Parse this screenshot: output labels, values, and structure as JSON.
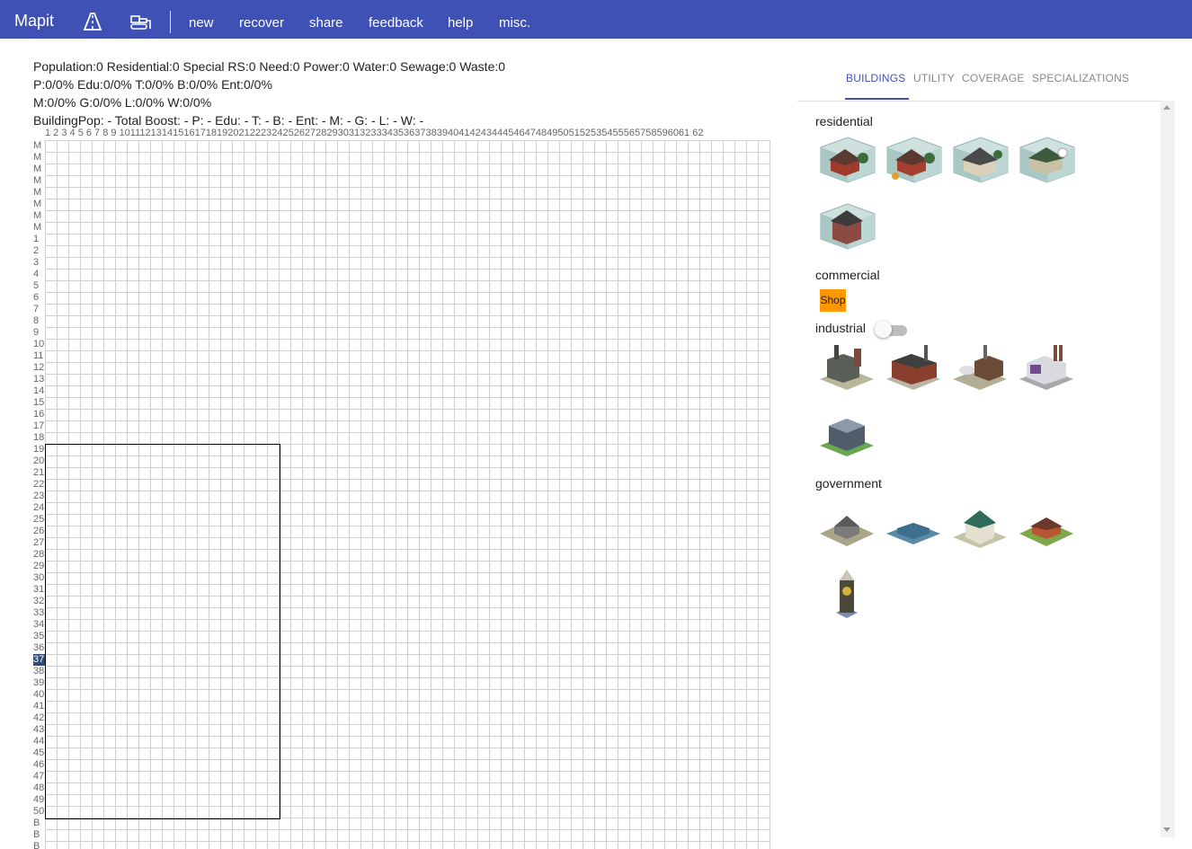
{
  "app": {
    "title": "Mapit"
  },
  "toolbar": {
    "icons": [
      "road-icon",
      "bulldozer-icon"
    ],
    "nav": [
      "new",
      "recover",
      "share",
      "feedback",
      "help",
      "misc."
    ]
  },
  "stats": {
    "line1": "Population:0  Residential:0  Special RS:0  Need:0  Power:0  Water:0  Sewage:0  Waste:0",
    "line2": "P:0/0%  Edu:0/0%  T:0/0%  B:0/0%  Ent:0/0%",
    "line3": "M:0/0%  G:0/0%  L:0/0%  W:0/0%",
    "line4": "BuildingPop: -  Total Boost: -  P: -  Edu: -  T: -  B: -  Ent: -  M: -  G: -  L: -  W: -"
  },
  "grid": {
    "column_numbers": "1 2 3 4 5 6 7 8 9 10111213141516171819202122232425262728293031323334353637383940414243444546474849505152535455565758596061 62",
    "row_labels": [
      "M",
      "M",
      "M",
      "M",
      "M",
      "M",
      "M",
      "M",
      "1",
      "2",
      "3",
      "4",
      "5",
      "6",
      "7",
      "8",
      "9",
      "10",
      "11",
      "12",
      "13",
      "14",
      "15",
      "16",
      "17",
      "18",
      "19",
      "20",
      "21",
      "22",
      "23",
      "24",
      "25",
      "26",
      "27",
      "28",
      "29",
      "30",
      "31",
      "32",
      "33",
      "34",
      "35",
      "36",
      "37",
      "38",
      "39",
      "40",
      "41",
      "42",
      "43",
      "44",
      "45",
      "46",
      "47",
      "48",
      "49",
      "50",
      "B",
      "B",
      "B"
    ],
    "highlighted_row": "37"
  },
  "tabs": [
    "BUILDINGS",
    "UTILITY",
    "COVERAGE",
    "SPECIALIZATIONS"
  ],
  "active_tab": "BUILDINGS",
  "panel": {
    "residential": {
      "label": "residential",
      "count": 5
    },
    "commercial": {
      "label": "commercial",
      "shop_label": "Shop"
    },
    "industrial": {
      "label": "industrial",
      "toggle_on": false,
      "count": 5
    },
    "government": {
      "label": "government",
      "count": 5
    }
  },
  "colors": {
    "accent": "#3f51b5",
    "shop": "#ff9800",
    "highlight_row": "#2d4a78"
  }
}
